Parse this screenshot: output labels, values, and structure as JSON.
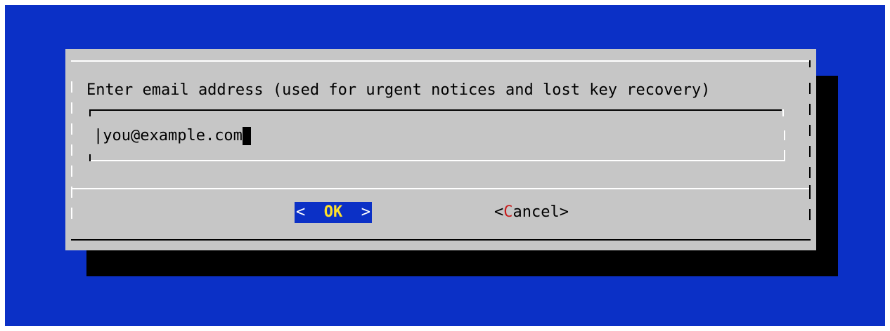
{
  "dialog": {
    "prompt": "Enter email address (used for urgent notices and lost key recovery)",
    "input": {
      "value": "you@example.com",
      "prefix": "|"
    },
    "buttons": {
      "ok": {
        "left": "<",
        "hot": "O",
        "rest": "K",
        "right": ">"
      },
      "cancel": {
        "left": "<",
        "hot": "C",
        "rest": "ancel",
        "right": ">"
      }
    }
  },
  "colors": {
    "background": "#0b30c6",
    "dialog": "#c6c6c6",
    "shadow": "#000000",
    "ok_hotkey": "#ffe02a",
    "cancel_hotkey": "#c81c1c"
  }
}
